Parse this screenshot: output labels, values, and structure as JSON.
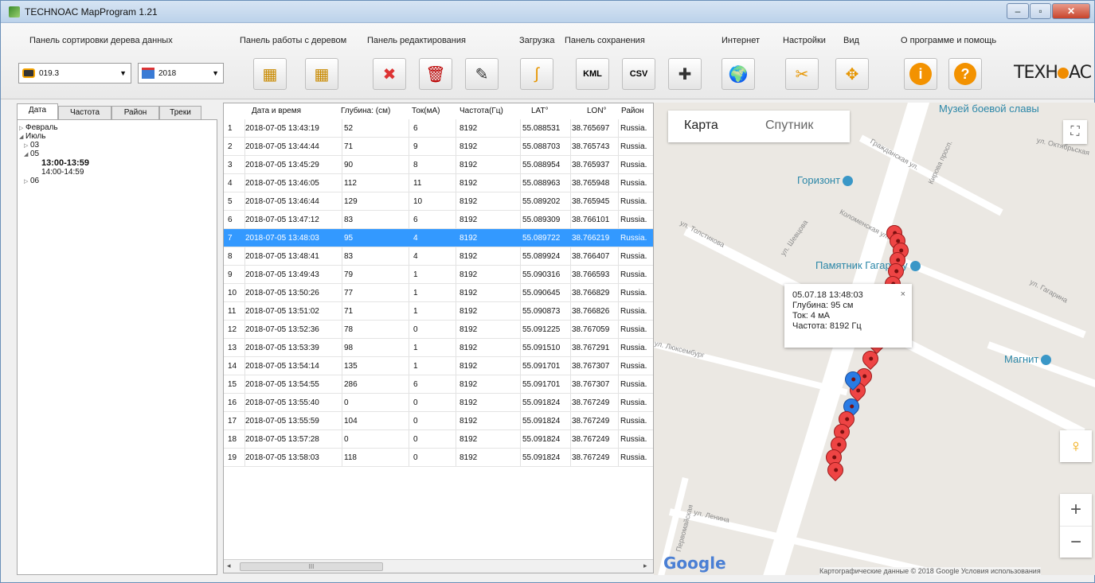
{
  "window": {
    "title": "TECHNOAC MapProgram 1.21"
  },
  "ribbon": {
    "groups": {
      "sort": "Панель сортировки дерева данных",
      "tree": "Панель работы с деревом",
      "edit": "Панель редактирования",
      "load": "Загрузка",
      "save": "Панель сохранения",
      "internet": "Интернет",
      "settings": "Настройки",
      "view": "Вид",
      "about": "О программе и помощь"
    },
    "device_combo": "019.3",
    "year_combo": "2018",
    "kml_label": "KML",
    "csv_label": "CSV",
    "logo_left": "TEXH",
    "logo_right": "AC"
  },
  "tabs": [
    "Дата",
    "Частота",
    "Район",
    "Треки"
  ],
  "tree": [
    {
      "label": "Февраль",
      "expander": "▷",
      "level": 0
    },
    {
      "label": "Июль",
      "expander": "◢",
      "level": 0
    },
    {
      "label": "03",
      "expander": "▷",
      "level": 1
    },
    {
      "label": "05",
      "expander": "◢",
      "level": 1
    },
    {
      "label": "13:00-13:59",
      "expander": "",
      "level": 2,
      "bold": true
    },
    {
      "label": "14:00-14:59",
      "expander": "",
      "level": 2
    },
    {
      "label": "06",
      "expander": "▷",
      "level": 1
    }
  ],
  "table": {
    "columns": [
      "Дата и время",
      "Глубина: (см)",
      "Ток(мА)",
      "Частота(Гц)",
      "LAT°",
      "LON°",
      "Район"
    ],
    "selected_row": 7,
    "rows": [
      {
        "n": "1",
        "dt": "2018-07-05 13:43:19",
        "depth": "52",
        "cur": "6",
        "freq": "8192",
        "lat": "55.088531",
        "lon": "38.765697",
        "region": "Russia."
      },
      {
        "n": "2",
        "dt": "2018-07-05 13:44:44",
        "depth": "71",
        "cur": "9",
        "freq": "8192",
        "lat": "55.088703",
        "lon": "38.765743",
        "region": "Russia."
      },
      {
        "n": "3",
        "dt": "2018-07-05 13:45:29",
        "depth": "90",
        "cur": "8",
        "freq": "8192",
        "lat": "55.088954",
        "lon": "38.765937",
        "region": "Russia."
      },
      {
        "n": "4",
        "dt": "2018-07-05 13:46:05",
        "depth": "112",
        "cur": "11",
        "freq": "8192",
        "lat": "55.088963",
        "lon": "38.765948",
        "region": "Russia."
      },
      {
        "n": "5",
        "dt": "2018-07-05 13:46:44",
        "depth": "129",
        "cur": "10",
        "freq": "8192",
        "lat": "55.089202",
        "lon": "38.765945",
        "region": "Russia."
      },
      {
        "n": "6",
        "dt": "2018-07-05 13:47:12",
        "depth": "83",
        "cur": "6",
        "freq": "8192",
        "lat": "55.089309",
        "lon": "38.766101",
        "region": "Russia."
      },
      {
        "n": "7",
        "dt": "2018-07-05 13:48:03",
        "depth": "95",
        "cur": "4",
        "freq": "8192",
        "lat": "55.089722",
        "lon": "38.766219",
        "region": "Russia."
      },
      {
        "n": "8",
        "dt": "2018-07-05 13:48:41",
        "depth": "83",
        "cur": "4",
        "freq": "8192",
        "lat": "55.089924",
        "lon": "38.766407",
        "region": "Russia."
      },
      {
        "n": "9",
        "dt": "2018-07-05 13:49:43",
        "depth": "79",
        "cur": "1",
        "freq": "8192",
        "lat": "55.090316",
        "lon": "38.766593",
        "region": "Russia."
      },
      {
        "n": "10",
        "dt": "2018-07-05 13:50:26",
        "depth": "77",
        "cur": "1",
        "freq": "8192",
        "lat": "55.090645",
        "lon": "38.766829",
        "region": "Russia."
      },
      {
        "n": "11",
        "dt": "2018-07-05 13:51:02",
        "depth": "71",
        "cur": "1",
        "freq": "8192",
        "lat": "55.090873",
        "lon": "38.766826",
        "region": "Russia."
      },
      {
        "n": "12",
        "dt": "2018-07-05 13:52:36",
        "depth": "78",
        "cur": "0",
        "freq": "8192",
        "lat": "55.091225",
        "lon": "38.767059",
        "region": "Russia."
      },
      {
        "n": "13",
        "dt": "2018-07-05 13:53:39",
        "depth": "98",
        "cur": "1",
        "freq": "8192",
        "lat": "55.091510",
        "lon": "38.767291",
        "region": "Russia."
      },
      {
        "n": "14",
        "dt": "2018-07-05 13:54:14",
        "depth": "135",
        "cur": "1",
        "freq": "8192",
        "lat": "55.091701",
        "lon": "38.767307",
        "region": "Russia."
      },
      {
        "n": "15",
        "dt": "2018-07-05 13:54:55",
        "depth": "286",
        "cur": "6",
        "freq": "8192",
        "lat": "55.091701",
        "lon": "38.767307",
        "region": "Russia."
      },
      {
        "n": "16",
        "dt": "2018-07-05 13:55:40",
        "depth": "0",
        "cur": "0",
        "freq": "8192",
        "lat": "55.091824",
        "lon": "38.767249",
        "region": "Russia."
      },
      {
        "n": "17",
        "dt": "2018-07-05 13:55:59",
        "depth": "104",
        "cur": "0",
        "freq": "8192",
        "lat": "55.091824",
        "lon": "38.767249",
        "region": "Russia."
      },
      {
        "n": "18",
        "dt": "2018-07-05 13:57:28",
        "depth": "0",
        "cur": "0",
        "freq": "8192",
        "lat": "55.091824",
        "lon": "38.767249",
        "region": "Russia."
      },
      {
        "n": "19",
        "dt": "2018-07-05 13:58:03",
        "depth": "118",
        "cur": "0",
        "freq": "8192",
        "lat": "55.091824",
        "lon": "38.767249",
        "region": "Russia."
      }
    ],
    "scroll_thumb": "III"
  },
  "map": {
    "type_map": "Карта",
    "type_satellite": "Спутник",
    "popup": {
      "time": "05.07.18 13:48:03",
      "depth": "Глубина: 95 см",
      "current": "Ток: 4 мА",
      "freq": "Частота: 8192 Гц",
      "close": "×"
    },
    "pois": [
      "Музей боевой славы",
      "Горизонт",
      "Памятник Гагарину",
      "Магнит"
    ],
    "streets": [
      "Кирова просп.",
      "Гражданская ул.",
      "Коломенская ул.",
      "ул. Толстикова",
      "ул. Шевцова",
      "ул. Гагарина",
      "ул. Октябрьская",
      "ул. Люксембург",
      "ул. Ленина",
      "Первомайская"
    ],
    "zoom_in": "+",
    "zoom_out": "−",
    "fullscreen": "⛶",
    "google": "Google",
    "attribution": "Картографические данные © 2018 Google   Условия использования"
  }
}
